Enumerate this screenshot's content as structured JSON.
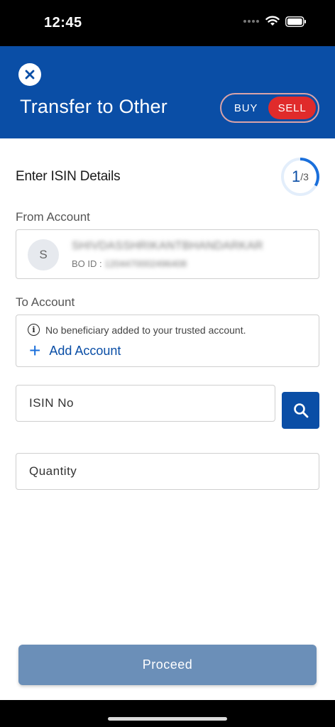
{
  "status_bar": {
    "time": "12:45"
  },
  "header": {
    "title": "Transfer to Other",
    "toggle": {
      "buy_label": "BUY",
      "sell_label": "SELL",
      "selected": "SELL"
    }
  },
  "section": {
    "title": "Enter ISIN Details",
    "step": {
      "current": "1",
      "total": "/3"
    }
  },
  "from_account": {
    "label": "From Account",
    "avatar_initial": "S",
    "name": "SHIVDASSHRIKANTBHANDARKAR",
    "bo_label": "BO ID :",
    "bo_value": "1204470002496408"
  },
  "to_account": {
    "label": "To Account",
    "info_text": "No beneficiary added to your trusted account.",
    "add_label": "Add Account"
  },
  "isin_input": {
    "placeholder": "ISIN No"
  },
  "quantity_input": {
    "placeholder": "Quantity"
  },
  "proceed_label": "Proceed",
  "colors": {
    "brand": "#0a4ea6",
    "sell": "#e02b2b",
    "proceed": "#6b8fb8"
  }
}
